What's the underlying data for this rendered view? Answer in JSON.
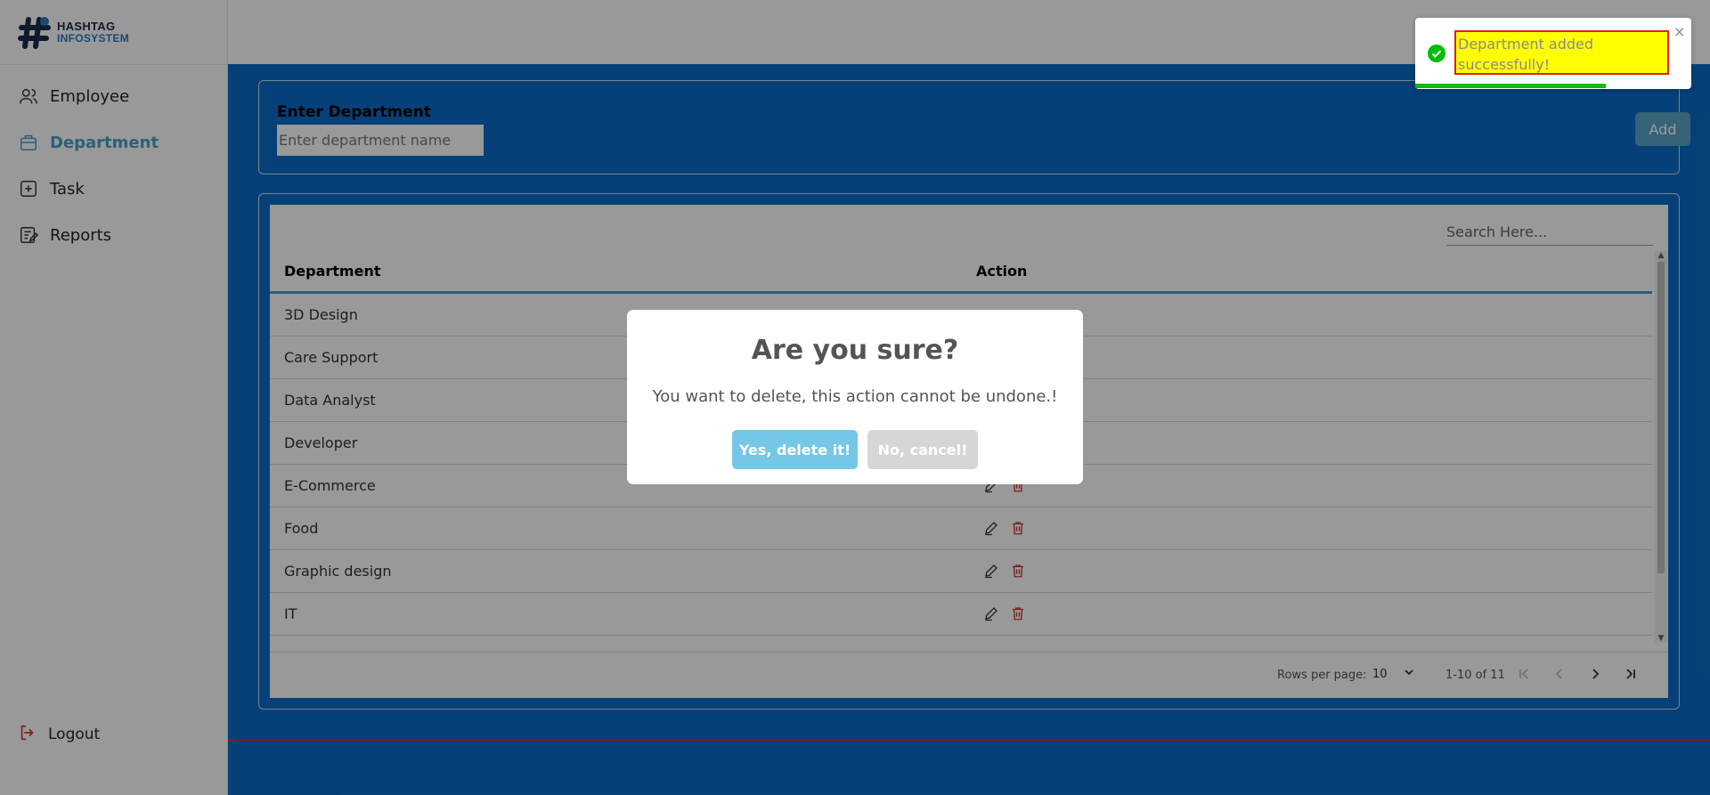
{
  "app": {
    "logo_line1": "HASHTAG",
    "logo_line2": "INFOSYSTEM"
  },
  "sidebar": {
    "items": [
      {
        "label": "Employee",
        "icon": "users-icon",
        "active": false
      },
      {
        "label": "Department",
        "icon": "department-icon",
        "active": true
      },
      {
        "label": "Task",
        "icon": "plus-square-icon",
        "active": false
      },
      {
        "label": "Reports",
        "icon": "report-icon",
        "active": false
      }
    ],
    "logout_label": "Logout"
  },
  "form": {
    "label": "Enter Department",
    "placeholder": "Enter department name",
    "add_label": "Add"
  },
  "table": {
    "search_placeholder": "Search Here...",
    "columns": [
      "Department",
      "Action"
    ],
    "rows": [
      "3D Design",
      "Care Support",
      "Data Analyst",
      "Developer",
      "E-Commerce",
      "Food",
      "Graphic design",
      "IT"
    ],
    "rows_per_page_label": "Rows per page:",
    "rows_per_page_value": "10",
    "range": "1-10 of 11"
  },
  "dialog": {
    "title": "Are you sure?",
    "text": "You want to delete, this action cannot be undone.!",
    "confirm_label": "Yes, delete it!",
    "cancel_label": "No, cancel!"
  },
  "toast": {
    "message": "Department added successfully!",
    "close": "×",
    "progress": 0.69
  },
  "colors": {
    "main_bg": "#0a6cc8",
    "accent": "#4a9fcc",
    "confirm": "#74c7e7",
    "danger": "#d43131",
    "success": "#07bc0c"
  }
}
